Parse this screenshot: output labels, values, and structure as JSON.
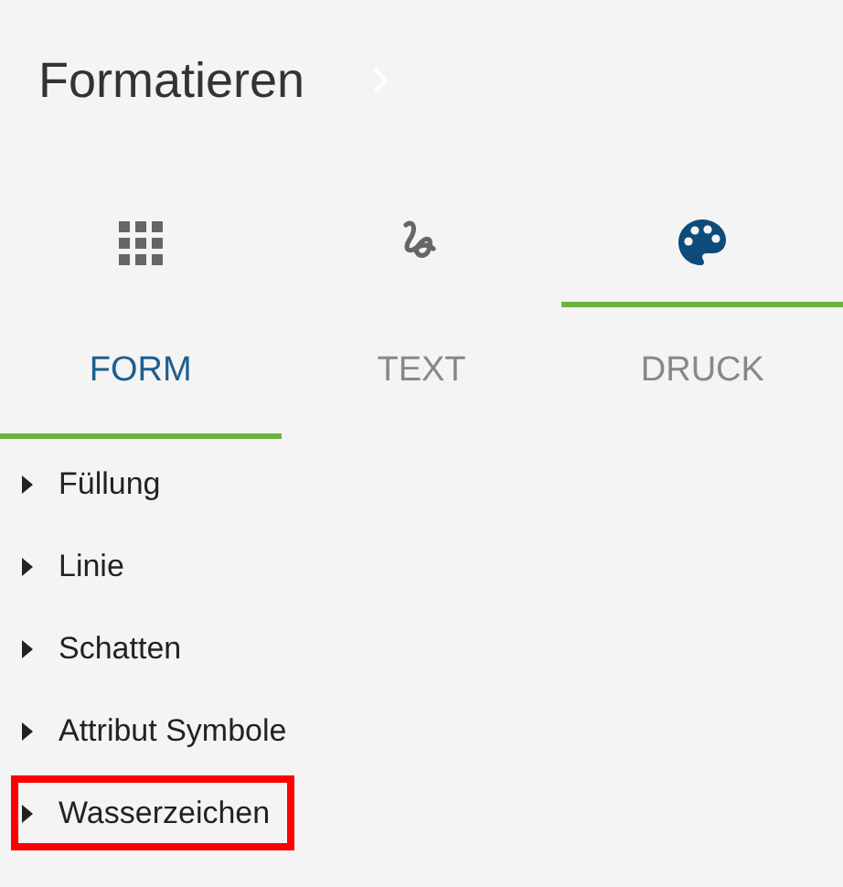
{
  "header": {
    "title": "Formatieren"
  },
  "icon_tabs": [
    {
      "kind": "grid",
      "selected": false
    },
    {
      "kind": "squiggle",
      "selected": false
    },
    {
      "kind": "palette",
      "selected": true
    }
  ],
  "tabs": [
    {
      "label": "FORM",
      "selected": true
    },
    {
      "label": "TEXT",
      "selected": false
    },
    {
      "label": "DRUCK",
      "selected": false
    }
  ],
  "sections": [
    {
      "label": "Füllung",
      "expanded": false,
      "highlighted": false
    },
    {
      "label": "Linie",
      "expanded": false,
      "highlighted": false
    },
    {
      "label": "Schatten",
      "expanded": false,
      "highlighted": false
    },
    {
      "label": "Attribut Symbole",
      "expanded": false,
      "highlighted": false
    },
    {
      "label": "Wasserzeichen",
      "expanded": false,
      "highlighted": true
    }
  ]
}
